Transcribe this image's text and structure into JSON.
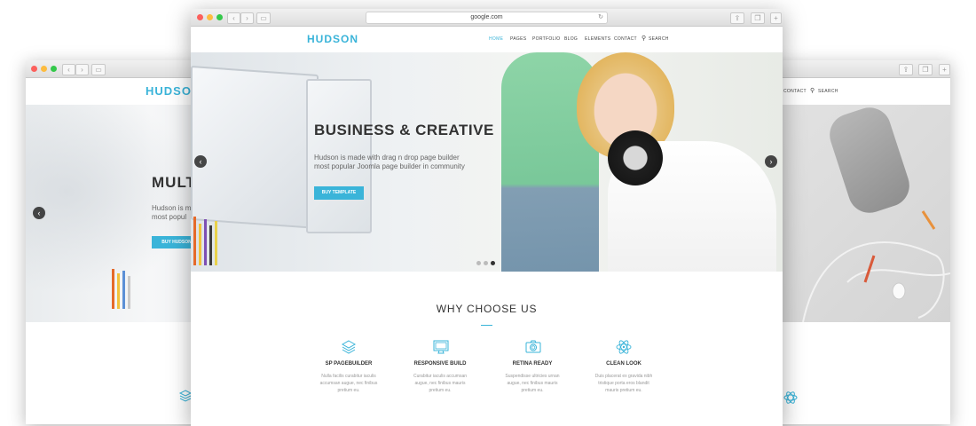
{
  "colors": {
    "accent": "#3ab4d9",
    "dark": "#333333"
  },
  "left_window": {
    "logo": "HUDSON",
    "heading": "MULT",
    "text_lines": [
      "Hudson is m",
      "most popul"
    ],
    "button": "BUY HUDSON"
  },
  "right_window": {
    "nav": [
      "CONTACT",
      "SEARCH"
    ]
  },
  "main_window": {
    "url": "google.com",
    "logo": "HUDSON",
    "nav": {
      "home": "HOME",
      "pages": "PAGES",
      "portfolio": "PORTFOLIO",
      "blog": "BLOG",
      "elements": "ELEMENTS",
      "contact": "CONTACT",
      "search": "SEARCH"
    },
    "hero": {
      "title": "BUSINESS & CREATIVE",
      "subtitle_line1": "Hudson is made with drag n drop page builder",
      "subtitle_line2": "most popular Joomla page builder in community",
      "button": "BUY TEMPLATE",
      "slides": 3,
      "active_slide": 2
    },
    "section_title": "WHY CHOOSE US",
    "features": [
      {
        "icon": "layers-icon",
        "title": "SP PAGEBUILDER",
        "desc": [
          "Nulla facilis curabitur iaculis",
          "accumsan augue, nec finibus",
          "pretium eu."
        ]
      },
      {
        "icon": "monitor-icon",
        "title": "RESPONSIVE BUILD",
        "desc": [
          "Curabitur iaculis accumsan",
          "augue, nec finibus mauris",
          "pretium eu."
        ]
      },
      {
        "icon": "camera-icon",
        "title": "RETINA READY",
        "desc": [
          "Suspendisse ultricies urnan",
          "augue, nec finibus mauris",
          "pretium eu."
        ]
      },
      {
        "icon": "atom-icon",
        "title": "CLEAN LOOK",
        "desc": [
          "Duis placerat ex gravida nibh",
          "tristique porta eros blandit",
          "mauris pretium eu."
        ]
      }
    ]
  }
}
